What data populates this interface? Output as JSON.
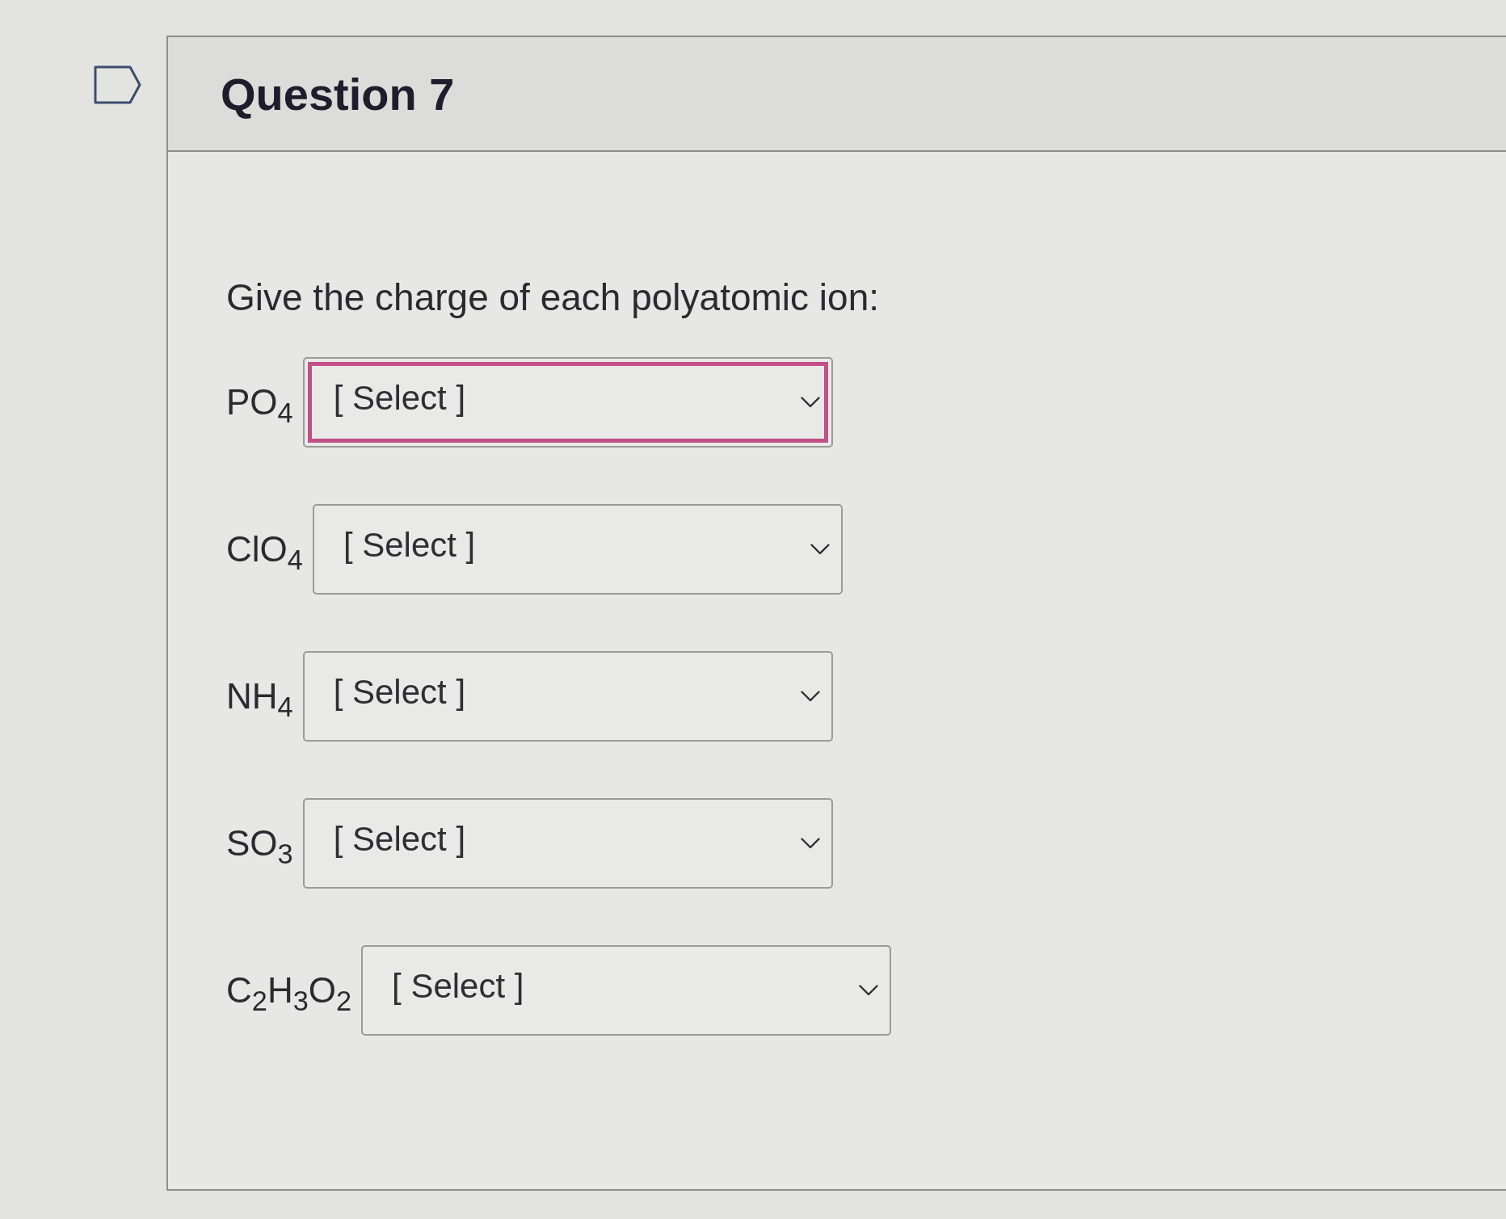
{
  "question": {
    "title": "Question 7",
    "flagged": false,
    "prompt": "Give the charge of each polyatomic ion:",
    "items": [
      {
        "label": "PO$_{4}$",
        "value": "[ Select ]",
        "focused": true
      },
      {
        "label": "ClO$_{4}$",
        "value": "[ Select ]",
        "focused": false
      },
      {
        "label": "NH$_{4}$",
        "value": "[ Select ]",
        "focused": false
      },
      {
        "label": "SO$_{3}$",
        "value": "[ Select ]",
        "focused": false
      },
      {
        "label": "C$_{2}$H$_{3}$O$_{2}$",
        "value": "[ Select ]",
        "focused": false
      }
    ]
  }
}
